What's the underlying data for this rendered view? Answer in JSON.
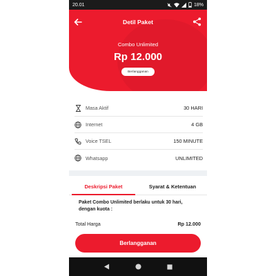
{
  "status_bar": {
    "time": "20.01",
    "battery": "18%",
    "icons": [
      "mute-icon",
      "wifi-icon",
      "signal-icon",
      "battery-icon"
    ]
  },
  "header": {
    "title": "Detil Paket",
    "back_icon": "arrow-left-icon",
    "share_icon": "share-icon"
  },
  "package": {
    "name": "Combo Unlimited",
    "price": "Rp 12.000",
    "badge": "Berlangganan"
  },
  "details": [
    {
      "icon": "hourglass-icon",
      "label": "Masa Aktif",
      "value": "30 HARI"
    },
    {
      "icon": "globe-icon",
      "label": "Internet",
      "value": "4 GB"
    },
    {
      "icon": "phone-icon",
      "label": "Voice TSEL",
      "value": "150 MINUTE"
    },
    {
      "icon": "globe-icon",
      "label": "Whatsapp",
      "value": "UNLIMITED"
    }
  ],
  "tabs": [
    {
      "label": "Deskripsi Paket",
      "active": true
    },
    {
      "label": "Syarat & Ketentuan",
      "active": false
    }
  ],
  "description": "Paket Combo Unlimited berlaku untuk 30 hari, dengan kuota :",
  "total": {
    "label": "Total Harga",
    "amount": "Rp 12.000"
  },
  "cta": {
    "label": "Berlangganan"
  },
  "colors": {
    "accent": "#ec1b2d",
    "divider": "#eef1f4"
  },
  "nav": {
    "icons": [
      "back-triangle-icon",
      "home-circle-icon",
      "recents-square-icon"
    ]
  }
}
